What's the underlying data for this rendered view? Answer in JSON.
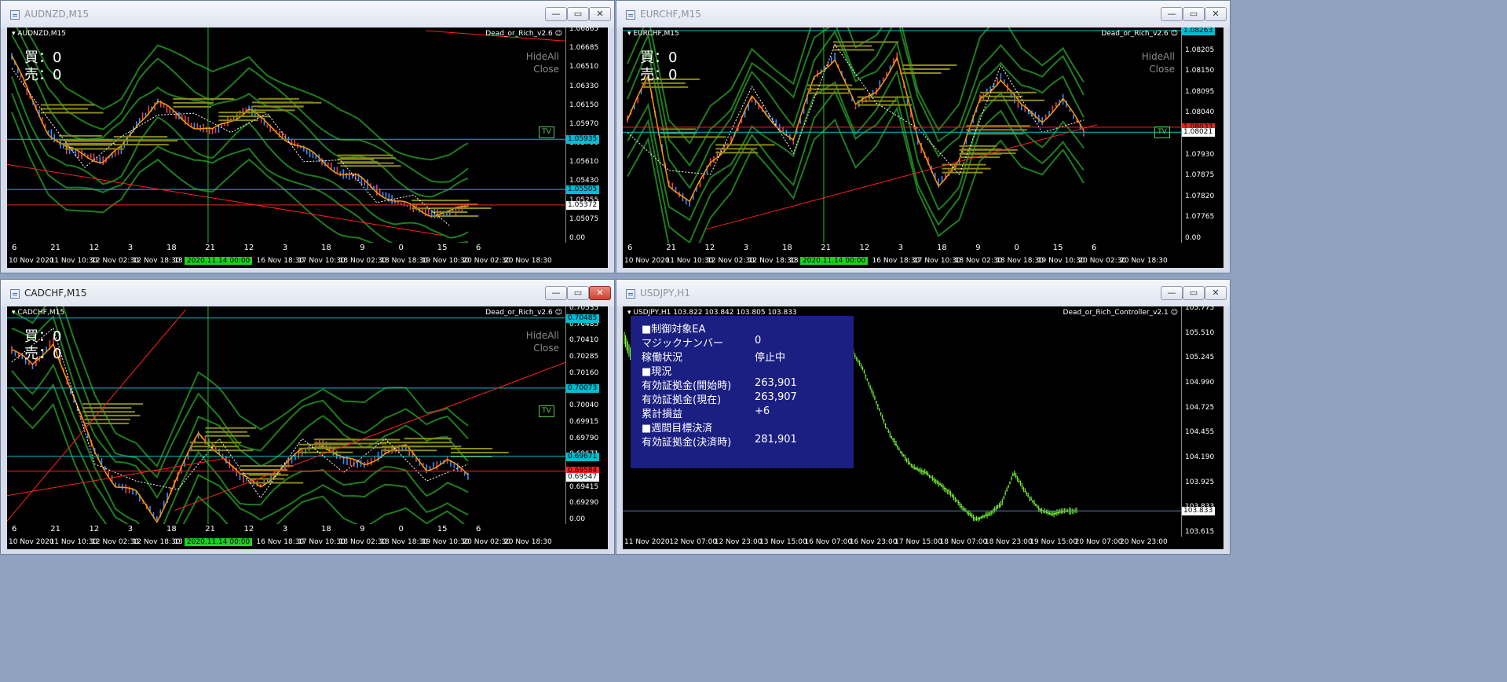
{
  "colors": {
    "chart_bg": "#000000",
    "cyan_line": "#00bcd4",
    "red_line": "#ff2020",
    "green_band": "#1f7d1f",
    "orange": "#ff9900",
    "panel_bg": "#1b1f82",
    "candle_up": "#3b8cff",
    "candle_down": "#e0455a",
    "usd_candle": "#7cff3a"
  },
  "windows": [
    {
      "id": "audnzd",
      "title": "AUDNZD,M15",
      "active": false,
      "close_red": false,
      "symbol_label": "AUDNZD,M15",
      "ea_label": "Dead_or_Rich_v2.6",
      "buy_label": "買：0",
      "sell_label": "売：0",
      "hide_all": "HideAll",
      "close_label": "Close",
      "tv_label": "TV",
      "y_ticks": [
        "1.06865",
        "1.06685",
        "1.06510",
        "1.06330",
        "1.06150",
        "1.05970",
        "1.05790",
        "1.05610",
        "1.05430",
        "1.05255",
        "1.05075",
        "0.00"
      ],
      "price_boxes": [
        {
          "value": "1.05935",
          "color": "#00bcd4"
        },
        {
          "value": "1.05505",
          "color": "#00bcd4"
        },
        {
          "value": "1.05372",
          "color": "#ffffff"
        }
      ],
      "x_labels": [
        "10 Nov 2020",
        "11 Nov 10:30",
        "12 Nov 02:30",
        "12 Nov 18:30",
        "13",
        "02:30",
        "16 Nov 18:30",
        "17 Nov 10:30",
        "18 Nov 02:30",
        "18 Nov 18:30",
        "19 Nov 10:30",
        "20 Nov 02:30",
        "20 Nov 18:30"
      ],
      "x_cursor": "2020.11.14 00:00",
      "periods": [
        "6",
        "21",
        "12",
        "3",
        "18",
        "21",
        "12",
        "3",
        "18",
        "9",
        "0",
        "15",
        "6"
      ]
    },
    {
      "id": "eurchf",
      "title": "EURCHF,M15",
      "active": false,
      "close_red": false,
      "symbol_label": "EURCHF,M15",
      "ea_label": "Dead_or_Rich_v2.6",
      "buy_label": "買：0",
      "sell_label": "売：0",
      "hide_all": "HideAll",
      "close_label": "Close",
      "tv_label": "TV",
      "y_ticks": [
        "1.08263",
        "1.08205",
        "1.08150",
        "1.08095",
        "1.08040",
        "1.07985",
        "1.07930",
        "1.07875",
        "1.07820",
        "1.07765",
        "0.00"
      ],
      "price_boxes": [
        {
          "value": "1.08263",
          "color": "#00bcd4"
        },
        {
          "value": "1.08033",
          "color": "#ff2020"
        },
        {
          "value": "1.08021",
          "color": "#ffffff"
        }
      ],
      "x_labels": [
        "10 Nov 2020",
        "11 Nov 10:30",
        "12 Nov 02:30",
        "12 Nov 18:30",
        "13",
        "02:30",
        "16 Nov 18:30",
        "17 Nov 10:30",
        "18 Nov 02:30",
        "18 Nov 18:30",
        "19 Nov 10:30",
        "20 Nov 02:30",
        "20 Nov 18:30"
      ],
      "x_cursor": "2020.11.14 00:00",
      "periods": [
        "6",
        "21",
        "12",
        "3",
        "18",
        "21",
        "12",
        "3",
        "18",
        "9",
        "0",
        "15",
        "6"
      ]
    },
    {
      "id": "cadchf",
      "title": "CADCHF,M15",
      "active": true,
      "close_red": true,
      "symbol_label": "CADCHF,M15",
      "ea_label": "Dead_or_Rich_v2.6",
      "buy_label": "買：0",
      "sell_label": "売：0",
      "hide_all": "HideAll",
      "close_label": "Close",
      "tv_label": "TV",
      "y_ticks": [
        "0.70535",
        "0.70485",
        "0.70410",
        "0.70285",
        "0.70160",
        "0.70073",
        "0.70040",
        "0.69915",
        "0.69790",
        "0.69671",
        "0.69547",
        "0.69415",
        "0.69290",
        "0.00"
      ],
      "price_boxes": [
        {
          "value": "0.70485",
          "color": "#00bcd4"
        },
        {
          "value": "0.70073",
          "color": "#00bcd4"
        },
        {
          "value": "0.69671",
          "color": "#00bcd4"
        },
        {
          "value": "0.69584",
          "color": "#ff2020"
        },
        {
          "value": "0.69547",
          "color": "#ffffff"
        }
      ],
      "x_labels": [
        "10 Nov 2020",
        "11 Nov 10:30",
        "12 Nov 02:30",
        "12 Nov 18:30",
        "13",
        "02:30",
        "16 Nov 18:30",
        "17 Nov 10:30",
        "18 Nov 02:30",
        "18 Nov 18:30",
        "19 Nov 10:30",
        "20 Nov 02:30",
        "20 Nov 18:30"
      ],
      "x_cursor": "2020.11.14 00:00",
      "periods": [
        "6",
        "21",
        "12",
        "3",
        "18",
        "21",
        "12",
        "3",
        "18",
        "9",
        "0",
        "15",
        "6"
      ]
    },
    {
      "id": "usdjpy",
      "title": "USDJPY,H1",
      "active": false,
      "close_red": false,
      "symbol_label": "USDJPY,H1  103.822 103.842 103.805 103.833",
      "ea_label": "Dead_or_Rich_Controller_v2.1",
      "y_ticks": [
        "105.775",
        "105.510",
        "105.245",
        "104.990",
        "104.725",
        "104.455",
        "104.190",
        "103.925",
        "103.833",
        "103.615"
      ],
      "price_boxes": [
        {
          "value": "103.833",
          "color": "#ffffff"
        }
      ],
      "x_labels": [
        "11 Nov 2020",
        "12 Nov 07:00",
        "12 Nov 23:00",
        "13 Nov 15:00",
        "16 Nov 07:00",
        "16 Nov 23:00",
        "17 Nov 15:00",
        "18 Nov 07:00",
        "18 Nov 23:00",
        "19 Nov 15:00",
        "20 Nov 07:00",
        "20 Nov 23:00"
      ],
      "panel": {
        "rows": [
          {
            "label": "■制御対象EA",
            "value": ""
          },
          {
            "label": "  マジックナンバー",
            "value": "0"
          },
          {
            "label": "  稼働状況",
            "value": "停止中"
          },
          {
            "label": "■現況",
            "value": ""
          },
          {
            "label": "  有効証拠金(開始時)",
            "value": "263,901"
          },
          {
            "label": "  有効証拠金(現在)",
            "value": "263,907"
          },
          {
            "label": "  累計損益",
            "value": "+6"
          },
          {
            "label": "■週間目標決済",
            "value": ""
          },
          {
            "label": "  有効証拠金(決済時)",
            "value": "281,901"
          }
        ]
      }
    }
  ],
  "chart_data": [
    {
      "type": "line",
      "symbol": "AUDNZD",
      "timeframe": "M15",
      "ylim": [
        1.05075,
        1.06865
      ],
      "close_approx": [
        1.0665,
        1.063,
        1.06,
        1.0585,
        1.058,
        1.0575,
        1.0585,
        1.061,
        1.0625,
        1.0615,
        1.0605,
        1.06,
        1.061,
        1.062,
        1.0605,
        1.0595,
        1.0585,
        1.0575,
        1.0565,
        1.056,
        1.055,
        1.054,
        1.0535,
        1.053,
        1.053,
        1.0537
      ]
    },
    {
      "type": "line",
      "symbol": "EURCHF",
      "timeframe": "M15",
      "ylim": [
        1.07765,
        1.08263
      ],
      "close_approx": [
        1.0805,
        1.0815,
        1.079,
        1.0785,
        1.0795,
        1.08,
        1.081,
        1.0805,
        1.08,
        1.0815,
        1.082,
        1.0808,
        1.0812,
        1.082,
        1.08,
        1.079,
        1.0795,
        1.081,
        1.0815,
        1.0808,
        1.0805,
        1.081,
        1.0802
      ]
    },
    {
      "type": "line",
      "symbol": "CADCHF",
      "timeframe": "M15",
      "ylim": [
        0.6929,
        0.70535
      ],
      "close_approx": [
        0.703,
        0.702,
        0.7035,
        0.7,
        0.697,
        0.695,
        0.6945,
        0.693,
        0.6955,
        0.698,
        0.697,
        0.6955,
        0.695,
        0.696,
        0.697,
        0.6975,
        0.6965,
        0.6962,
        0.697,
        0.6972,
        0.696,
        0.6965,
        0.6955
      ]
    },
    {
      "type": "line",
      "symbol": "USDJPY",
      "timeframe": "H1",
      "ylim": [
        103.615,
        105.775
      ],
      "close_approx": [
        105.4,
        105.2,
        104.9,
        104.6,
        104.4,
        104.25,
        104.2,
        104.1,
        104.0,
        103.85,
        103.75,
        103.8,
        103.9,
        104.2,
        104.0,
        103.85,
        103.8,
        103.83,
        103.833
      ]
    }
  ]
}
